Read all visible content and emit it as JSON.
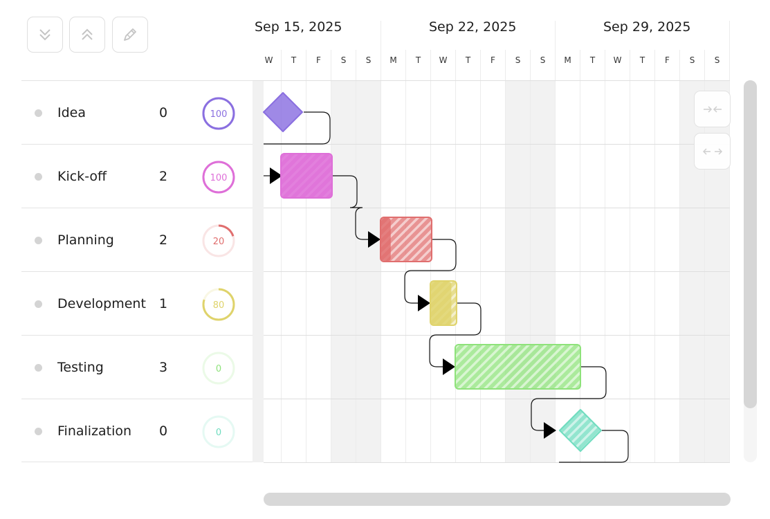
{
  "toolbar": {
    "buttons": [
      {
        "icon": "collapse-all-icon"
      },
      {
        "icon": "expand-all-icon"
      },
      {
        "icon": "pencil-icon"
      }
    ]
  },
  "timeline": {
    "weeks": [
      "Sep 15, 2025",
      "Sep 22, 2025",
      "Sep 29, 2025"
    ],
    "days": [
      "W",
      "T",
      "F",
      "S",
      "S",
      "M",
      "T",
      "W",
      "T",
      "F",
      "S",
      "S",
      "M",
      "T",
      "W",
      "T",
      "F",
      "S",
      "S"
    ],
    "weekend_color": "#f2f2f2"
  },
  "tasks": [
    {
      "name": "Idea",
      "duration": "0",
      "progress": "100",
      "progress_value": 100,
      "color": "#8a6fe0",
      "type": "milestone"
    },
    {
      "name": "Kick-off",
      "duration": "2",
      "progress": "100",
      "progress_value": 100,
      "color": "#de6fd8",
      "type": "task"
    },
    {
      "name": "Planning",
      "duration": "2",
      "progress": "20",
      "progress_value": 20,
      "color": "#e06e6e",
      "type": "task"
    },
    {
      "name": "Development",
      "duration": "1",
      "progress": "80",
      "progress_value": 80,
      "color": "#dfd36b",
      "type": "task"
    },
    {
      "name": "Testing",
      "duration": "3",
      "progress": "0",
      "progress_value": 0,
      "color": "#8ee27a",
      "type": "task"
    },
    {
      "name": "Finalization",
      "duration": "0",
      "progress": "0",
      "progress_value": 0,
      "color": "#6fdcbf",
      "type": "milestone"
    }
  ],
  "side_controls": [
    {
      "icon": "collapse-horizontal-icon"
    },
    {
      "icon": "expand-horizontal-icon"
    }
  ]
}
